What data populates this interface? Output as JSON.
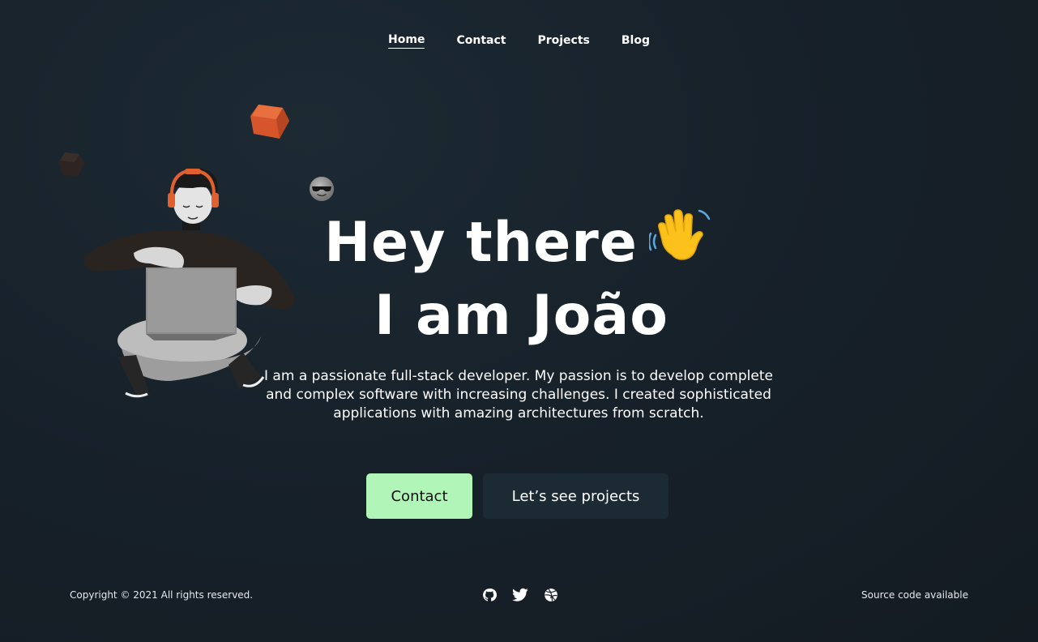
{
  "nav": {
    "items": [
      {
        "label": "Home",
        "active": true
      },
      {
        "label": "Contact",
        "active": false
      },
      {
        "label": "Projects",
        "active": false
      },
      {
        "label": "Blog",
        "active": false
      }
    ]
  },
  "hero": {
    "title_line1": "Hey there",
    "title_line2": "I am João",
    "title_emoji": "waving-hand-icon",
    "description": "I am a  passionate full-stack developer. My passion is to develop complete and complex software with increasing challenges. I created sophisticated applications with amazing architectures from scratch.",
    "primary_button": "Contact",
    "secondary_button": "Let’s see projects"
  },
  "footer": {
    "copyright": "Copyright © 2021 All rights reserved.",
    "socials": [
      "github-icon",
      "twitter-icon",
      "dribbble-icon"
    ],
    "source": "Source code available"
  },
  "colors": {
    "background": "#17212a",
    "primary_button": "#b1f5b8",
    "secondary_button": "#1b2a33",
    "accent": "#e0602f",
    "text": "#ffffff"
  }
}
